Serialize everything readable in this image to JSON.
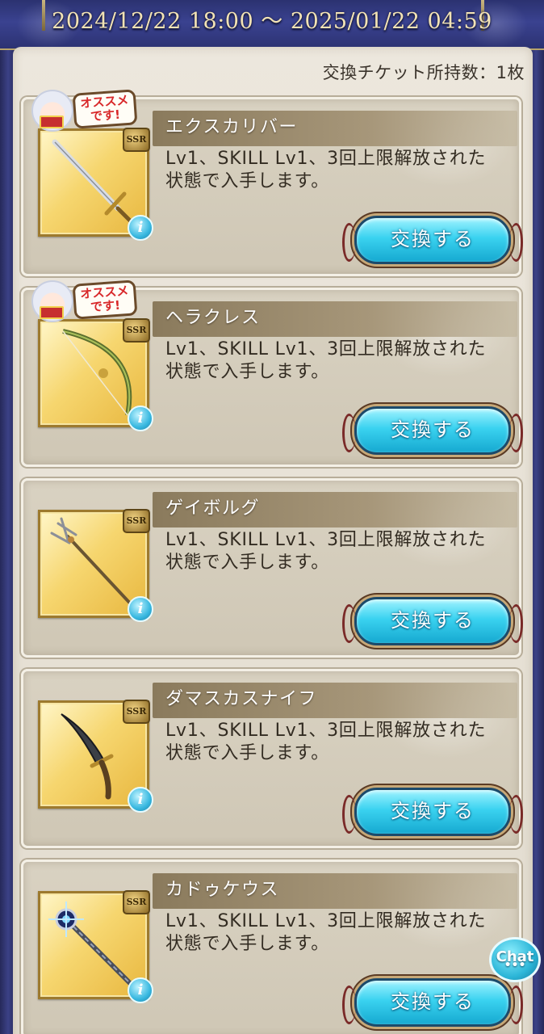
{
  "header": {
    "period": "2024/12/22 18:00 〜 2025/01/22 04:59"
  },
  "ticket_count": "交換チケット所持数：1枚",
  "recommend_badge": "オススメ\nです!",
  "ssr_badge": "SSR",
  "info_glyph": "i",
  "exchange_label": "交換する",
  "items": [
    {
      "name": "エクスカリバー",
      "desc": "Lv1、SKILL Lv1、3回上限解放された状態で入手します。",
      "recommended": true,
      "weapon": "sword"
    },
    {
      "name": "ヘラクレス",
      "desc": "Lv1、SKILL Lv1、3回上限解放された状態で入手します。",
      "recommended": true,
      "weapon": "bow"
    },
    {
      "name": "ゲイボルグ",
      "desc": "Lv1、SKILL Lv1、3回上限解放された状態で入手します。",
      "recommended": false,
      "weapon": "spear"
    },
    {
      "name": "ダマスカスナイフ",
      "desc": "Lv1、SKILL Lv1、3回上限解放された状態で入手します。",
      "recommended": false,
      "weapon": "dagger"
    },
    {
      "name": "カドゥケウス",
      "desc": "Lv1、SKILL Lv1、3回上限解放された状態で入手します。",
      "recommended": false,
      "weapon": "staff"
    }
  ],
  "chat": {
    "label": "Chat",
    "dots": "•••"
  }
}
